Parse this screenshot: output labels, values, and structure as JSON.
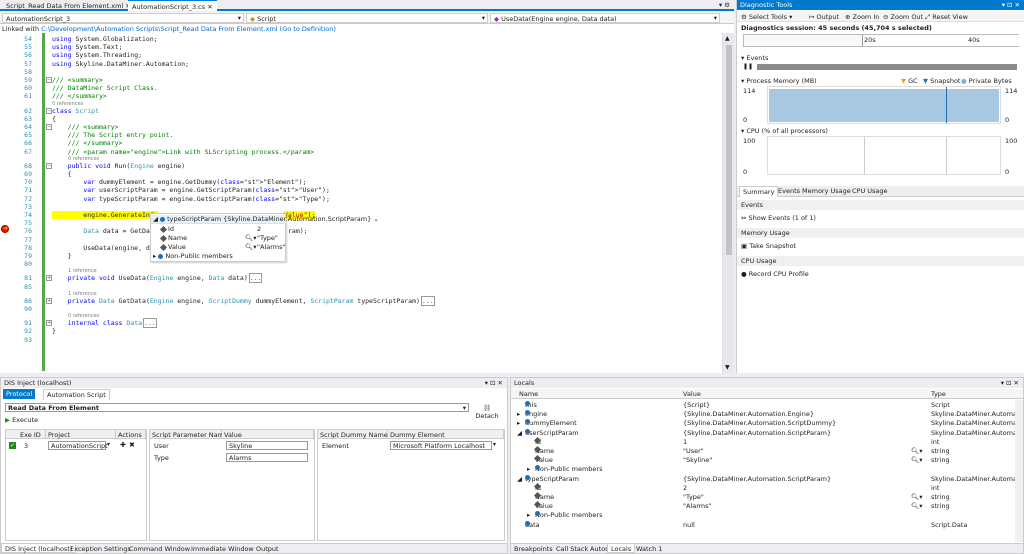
{
  "doc_tabs": [
    {
      "label": "Script_Read Data From Element.xml",
      "active": false
    },
    {
      "label": "AutomationScript_3.cs",
      "active": true
    }
  ],
  "nav": {
    "project": "AutomationScript_3",
    "class": "Script",
    "member": "UseData(Engine engine, Data data)"
  },
  "linked": {
    "prefix": "Linked with",
    "path": "C:\\Development\\Automation Scripts\\Script_Read Data From Element.xml",
    "goto": "(Go to Definition)"
  },
  "code_lines": [
    {
      "n": "54",
      "t": "using System.Globalization;"
    },
    {
      "n": "55",
      "t": "using System.Text;"
    },
    {
      "n": "56",
      "t": "using System.Threading;"
    },
    {
      "n": "57",
      "t": "using Skyline.DataMiner.Automation;"
    },
    {
      "n": "58",
      "t": ""
    },
    {
      "n": "59",
      "t": "/// <summary>"
    },
    {
      "n": "60",
      "t": "/// DataMiner Script Class."
    },
    {
      "n": "61",
      "t": "/// </summary>"
    },
    {
      "n": "62",
      "t": "class Script"
    },
    {
      "n": "63",
      "t": "{"
    },
    {
      "n": "64",
      "t": "    /// <summary>"
    },
    {
      "n": "65",
      "t": "    /// The Script entry point."
    },
    {
      "n": "66",
      "t": "    /// </summary>"
    },
    {
      "n": "67",
      "t": "    /// <param name=\"engine\">Link with SLScripting process.</param>"
    },
    {
      "n": "68",
      "t": "    public void Run(Engine engine)"
    },
    {
      "n": "69",
      "t": "    {"
    },
    {
      "n": "70",
      "t": "        var dummyElement = engine.GetDummy(\"Element\");"
    },
    {
      "n": "71",
      "t": "        var userScriptParam = engine.GetScriptParam(\"User\");"
    },
    {
      "n": "72",
      "t": "        var typeScriptParam = engine.GetScriptParam(\"Type\");"
    },
    {
      "n": "73",
      "t": ""
    },
    {
      "n": "74",
      "t": "        engine.GenerateInfo"
    },
    {
      "n": "75",
      "t": ""
    },
    {
      "n": "76",
      "t": "        Data data = GetData"
    },
    {
      "n": "77",
      "t": ""
    },
    {
      "n": "78",
      "t": "        UseData(engine, data);"
    },
    {
      "n": "79",
      "t": "    }"
    },
    {
      "n": "80",
      "t": ""
    },
    {
      "n": "81",
      "t": "    private void UseData(Engine engine, Data data)"
    },
    {
      "n": "85",
      "t": ""
    },
    {
      "n": "86",
      "t": "    private Data GetData(Engine engine, ScriptDummy dummyElement, ScriptParam typeScriptParam)"
    },
    {
      "n": "90",
      "t": ""
    },
    {
      "n": "91",
      "t": "    internal class Data"
    },
    {
      "n": "92",
      "t": "}"
    },
    {
      "n": "93",
      "t": ""
    }
  ],
  "code_fragments": {
    "line74_tail": "Value\");",
    "line76_tail": "ram);",
    "ellipsis": "..."
  },
  "references": {
    "zero": "0 references",
    "one": "1 reference"
  },
  "datatip": {
    "header": "typeScriptParam {Skyline.DataMiner.Automation.ScriptParam}",
    "rows": [
      {
        "name": "Id",
        "value": "2"
      },
      {
        "name": "Name",
        "value": "\"Type\""
      },
      {
        "name": "Value",
        "value": "\"Alarms\""
      },
      {
        "name": "Non-Public members",
        "value": ""
      }
    ]
  },
  "diag": {
    "title": "Diagnostic Tools",
    "toolbar": [
      "Select Tools",
      "Output",
      "Zoom In",
      "Zoom Out",
      "Reset View"
    ],
    "session": "Diagnostics session: 45 seconds (45,704 s selected)",
    "ticks": [
      "20s",
      "40s"
    ],
    "events_label": "Events",
    "memory_title": "Process Memory (MB)",
    "memory_legend": [
      "GC",
      "Snapshot",
      "Private Bytes"
    ],
    "memory_max": "114",
    "memory_min": "0",
    "cpu_title": "CPU (% of all processors)",
    "cpu_max": "100",
    "cpu_min": "0",
    "tabs": [
      "Summary",
      "Events",
      "Memory Usage",
      "CPU Usage"
    ],
    "sections": [
      {
        "header": "Events",
        "action": "Show Events (1 of 1)"
      },
      {
        "header": "Memory Usage",
        "action": "Take Snapshot"
      },
      {
        "header": "CPU Usage",
        "action": "Record CPU Profile"
      }
    ]
  },
  "dis": {
    "title": "DIS Inject (localhost)",
    "tabs": [
      "Protocol",
      "Automation Script"
    ],
    "script_name": "Read Data From Element",
    "detach": "Detach",
    "execute": "Execute",
    "exec_headers": [
      "Exe ID",
      "Project",
      "Actions"
    ],
    "exec_row": {
      "id": "3",
      "project": "AutomationScript"
    },
    "param_headers": [
      "Script Parameter Name",
      "Value"
    ],
    "params": [
      {
        "name": "User",
        "value": "Skyline"
      },
      {
        "name": "Type",
        "value": "Alarms"
      }
    ],
    "dummy_headers": [
      "Script Dummy Name",
      "Dummy Element"
    ],
    "dummies": [
      {
        "name": "Element",
        "value": "Microsoft Platform Localhost"
      }
    ],
    "bottom_tabs": [
      "DIS Inject (localhost)",
      "Exception Settings",
      "Command Window",
      "Immediate Window",
      "Output"
    ]
  },
  "locals": {
    "title": "Locals",
    "headers": [
      "Name",
      "Value",
      "Type"
    ],
    "rows": [
      {
        "indent": 0,
        "exp": "",
        "name": "this",
        "value": "{Script}",
        "type": "Script"
      },
      {
        "indent": 0,
        "exp": "▸",
        "name": "engine",
        "value": "{Skyline.DataMiner.Automation.Engine}",
        "type": "Skyline.DataMiner.Automati..."
      },
      {
        "indent": 0,
        "exp": "▸",
        "name": "dummyElement",
        "value": "{Skyline.DataMiner.Automation.ScriptDummy}",
        "type": "Skyline.DataMiner.Automati..."
      },
      {
        "indent": 0,
        "exp": "◢",
        "name": "userScriptParam",
        "value": "{Skyline.DataMiner.Automation.ScriptParam}",
        "type": "Skyline.DataMiner.Automati..."
      },
      {
        "indent": 1,
        "exp": "",
        "name": "Id",
        "value": "1",
        "type": "int"
      },
      {
        "indent": 1,
        "exp": "",
        "name": "Name",
        "value": "\"User\"",
        "type": "string"
      },
      {
        "indent": 1,
        "exp": "",
        "name": "Value",
        "value": "\"Skyline\"",
        "type": "string"
      },
      {
        "indent": 1,
        "exp": "▸",
        "name": "Non-Public members",
        "value": "",
        "type": ""
      },
      {
        "indent": 0,
        "exp": "◢",
        "name": "typeScriptParam",
        "value": "{Skyline.DataMiner.Automation.ScriptParam}",
        "type": "Skyline.DataMiner.Automati..."
      },
      {
        "indent": 1,
        "exp": "",
        "name": "Id",
        "value": "2",
        "type": "int"
      },
      {
        "indent": 1,
        "exp": "",
        "name": "Name",
        "value": "\"Type\"",
        "type": "string"
      },
      {
        "indent": 1,
        "exp": "",
        "name": "Value",
        "value": "\"Alarms\"",
        "type": "string"
      },
      {
        "indent": 1,
        "exp": "▸",
        "name": "Non-Public members",
        "value": "",
        "type": ""
      },
      {
        "indent": 0,
        "exp": "",
        "name": "data",
        "value": "null",
        "type": "Script.Data"
      }
    ],
    "bottom_tabs": [
      "Breakpoints",
      "Call Stack",
      "Autos",
      "Locals",
      "Watch 1"
    ]
  },
  "colors": {
    "accent": "#007acc",
    "keyword": "#0000ff",
    "type": "#2b91af",
    "string": "#a31515",
    "comment": "#008000",
    "memory_fill": "#a7c8e0"
  }
}
